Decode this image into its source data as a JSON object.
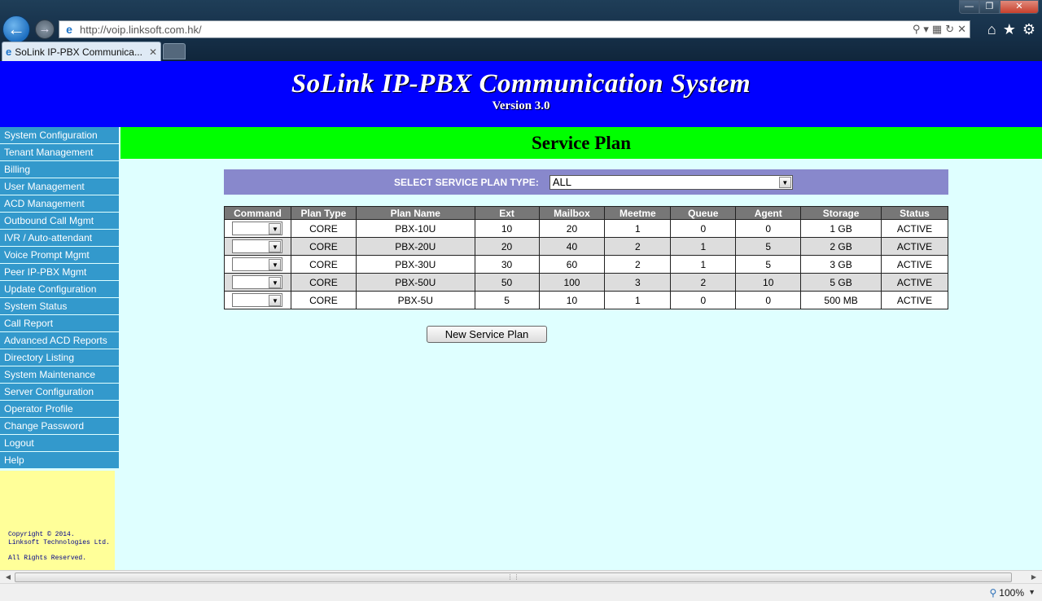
{
  "browser": {
    "url": "http://voip.linksoft.com.hk/",
    "tab_title": "SoLink IP-PBX Communica...",
    "zoom": "100%"
  },
  "header": {
    "title": "SoLink IP-PBX Communication System",
    "version": "Version 3.0"
  },
  "sidebar": {
    "items": [
      "System Configuration",
      "Tenant Management",
      "Billing",
      "User Management",
      "ACD Management",
      "Outbound Call Mgmt",
      "IVR / Auto-attendant",
      "Voice Prompt Mgmt",
      "Peer IP-PBX Mgmt",
      "Update Configuration",
      "System Status",
      "Call Report",
      "Advanced ACD Reports",
      "Directory Listing",
      "System Maintenance",
      "Server Configuration",
      "Operator Profile",
      "Change Password",
      "Logout",
      "Help"
    ],
    "copyright": [
      "Copyright © 2014.",
      "Linksoft Technologies Ltd.",
      "",
      "All Rights Reserved."
    ]
  },
  "main": {
    "page_title": "Service Plan",
    "filter_label": "SELECT SERVICE PLAN TYPE:",
    "filter_value": "ALL",
    "table": {
      "headers": [
        "Command",
        "Plan Type",
        "Plan Name",
        "Ext",
        "Mailbox",
        "Meetme",
        "Queue",
        "Agent",
        "Storage",
        "Status"
      ],
      "rows": [
        [
          "",
          "CORE",
          "PBX-10U",
          "10",
          "20",
          "1",
          "0",
          "0",
          "1 GB",
          "ACTIVE"
        ],
        [
          "",
          "CORE",
          "PBX-20U",
          "20",
          "40",
          "2",
          "1",
          "5",
          "2 GB",
          "ACTIVE"
        ],
        [
          "",
          "CORE",
          "PBX-30U",
          "30",
          "60",
          "2",
          "1",
          "5",
          "3 GB",
          "ACTIVE"
        ],
        [
          "",
          "CORE",
          "PBX-50U",
          "50",
          "100",
          "3",
          "2",
          "10",
          "5 GB",
          "ACTIVE"
        ],
        [
          "",
          "CORE",
          "PBX-5U",
          "5",
          "10",
          "1",
          "0",
          "0",
          "500 MB",
          "ACTIVE"
        ]
      ]
    },
    "new_button": "New Service Plan"
  },
  "colors": {
    "header_bg": "#0000ff",
    "title_bar_bg": "#00ff00",
    "nav_bg": "#3399cc",
    "filter_bg": "#8888cc",
    "page_bg": "#dfffff",
    "copyright_bg": "#ffff99"
  }
}
